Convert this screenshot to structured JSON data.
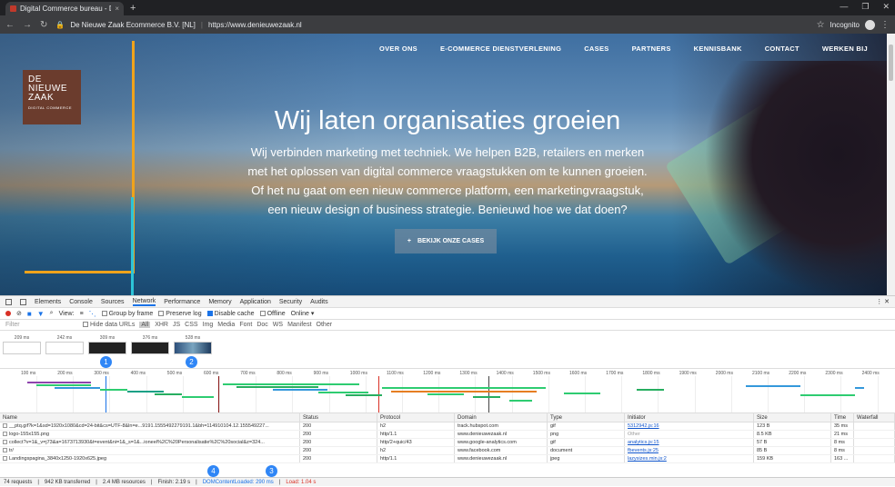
{
  "browser": {
    "tab_title": "Digital Commerce bureau - De N",
    "tab_close": "×",
    "new_tab": "+",
    "url_owner": "De Nieuwe Zaak Ecommerce B.V. [NL]",
    "url": "https://www.denieuwezaak.nl",
    "incognito_label": "Incognito"
  },
  "site": {
    "logo_line1": "DE",
    "logo_line2": "NIEUWE",
    "logo_line3": "ZAAK",
    "logo_tagline": "DIGITAL COMMERCE",
    "nav": [
      "OVER ONS",
      "E-COMMERCE DIENSTVERLENING",
      "CASES",
      "PARTNERS",
      "KENNISBANK",
      "CONTACT",
      "WERKEN BIJ"
    ],
    "hero_title": "Wij laten organisaties groeien",
    "hero_text": "Wij verbinden marketing met techniek. We helpen B2B, retailers en merken met het oplossen van digital commerce vraagstukken om te kunnen groeien. Of het nu gaat om een nieuw commerce platform, een marketingvraagstuk, een nieuw design of business strategie. Benieuwd hoe we dat doen?",
    "cta_label": "BEKIJK ONZE CASES"
  },
  "devtools": {
    "tabs": [
      "Elements",
      "Console",
      "Sources",
      "Network",
      "Performance",
      "Memory",
      "Application",
      "Security",
      "Audits"
    ],
    "active_tab": "Network",
    "toolbar": {
      "view_label": "View:",
      "group_by_frame": "Group by frame",
      "preserve_log": "Preserve log",
      "disable_cache": "Disable cache",
      "offline": "Offline",
      "online": "Online"
    },
    "filter": {
      "placeholder": "Filter",
      "hide_data_urls": "Hide data URLs",
      "types": [
        "All",
        "XHR",
        "JS",
        "CSS",
        "Img",
        "Media",
        "Font",
        "Doc",
        "WS",
        "Manifest",
        "Other"
      ]
    },
    "filmstrip": [
      "209 ms",
      "242 ms",
      "309 ms",
      "376 ms",
      "528 ms"
    ],
    "markers": [
      "1",
      "2",
      "3",
      "4"
    ],
    "ticks": [
      "100 ms",
      "200 ms",
      "300 ms",
      "400 ms",
      "500 ms",
      "600 ms",
      "700 ms",
      "800 ms",
      "900 ms",
      "1000 ms",
      "1100 ms",
      "1200 ms",
      "1300 ms",
      "1400 ms",
      "1500 ms",
      "1600 ms",
      "1700 ms",
      "1800 ms",
      "1900 ms",
      "2000 ms",
      "2100 ms",
      "2200 ms",
      "2300 ms",
      "2400 ms"
    ],
    "columns": [
      "Name",
      "Status",
      "Protocol",
      "Domain",
      "Type",
      "Initiator",
      "Size",
      "Time",
      "Waterfall"
    ],
    "rows": [
      {
        "name": "__ptq.gif?k=1&sd=1920x1080&cd=24-bit&cs=UTF-8&ln=e...9191.1555492279191.1&bh=114910104.12.155549227...",
        "status": "200",
        "protocol": "h2",
        "domain": "track.hubspot.com",
        "type": "gif",
        "initiator": "5312942.js:16",
        "size": "123 B",
        "time": "35 ms"
      },
      {
        "name": "logo-155x155.png",
        "status": "200",
        "protocol": "http/1.1",
        "domain": "www.denieuwezaak.nl",
        "type": "png",
        "initiator": "Other",
        "size": "8.5 KB",
        "time": "21 ms"
      },
      {
        "name": "collect?v=1&_v=j73&a=1673713930&t=event&ni=1&_s=1&...ioneel%2C%20Personalisatie%2C%20social&z=324...",
        "status": "200",
        "protocol": "http/2+quic/43",
        "domain": "www.google-analytics.com",
        "type": "gif",
        "initiator": "analytics.js:15",
        "size": "57 B",
        "time": "8 ms"
      },
      {
        "name": "tr/",
        "status": "200",
        "protocol": "h2",
        "domain": "www.facebook.com",
        "type": "document",
        "initiator": "fbevents.js:25",
        "size": "85 B",
        "time": "8 ms"
      },
      {
        "name": "Landingspagina_3840x1250-1920x625.jpeg",
        "status": "200",
        "protocol": "http/1.1",
        "domain": "www.denieuwezaak.nl",
        "type": "jpeg",
        "initiator": "lazysizes.min.js:2",
        "size": "159 KB",
        "time": "163 ..."
      }
    ],
    "status_bar": {
      "requests": "74 requests",
      "transferred": "942 KB transferred",
      "resources": "2.4 MB resources",
      "finish": "Finish: 2.19 s",
      "dom_content_loaded": "DOMContentLoaded: 290 ms",
      "load": "Load: 1.04 s"
    }
  }
}
